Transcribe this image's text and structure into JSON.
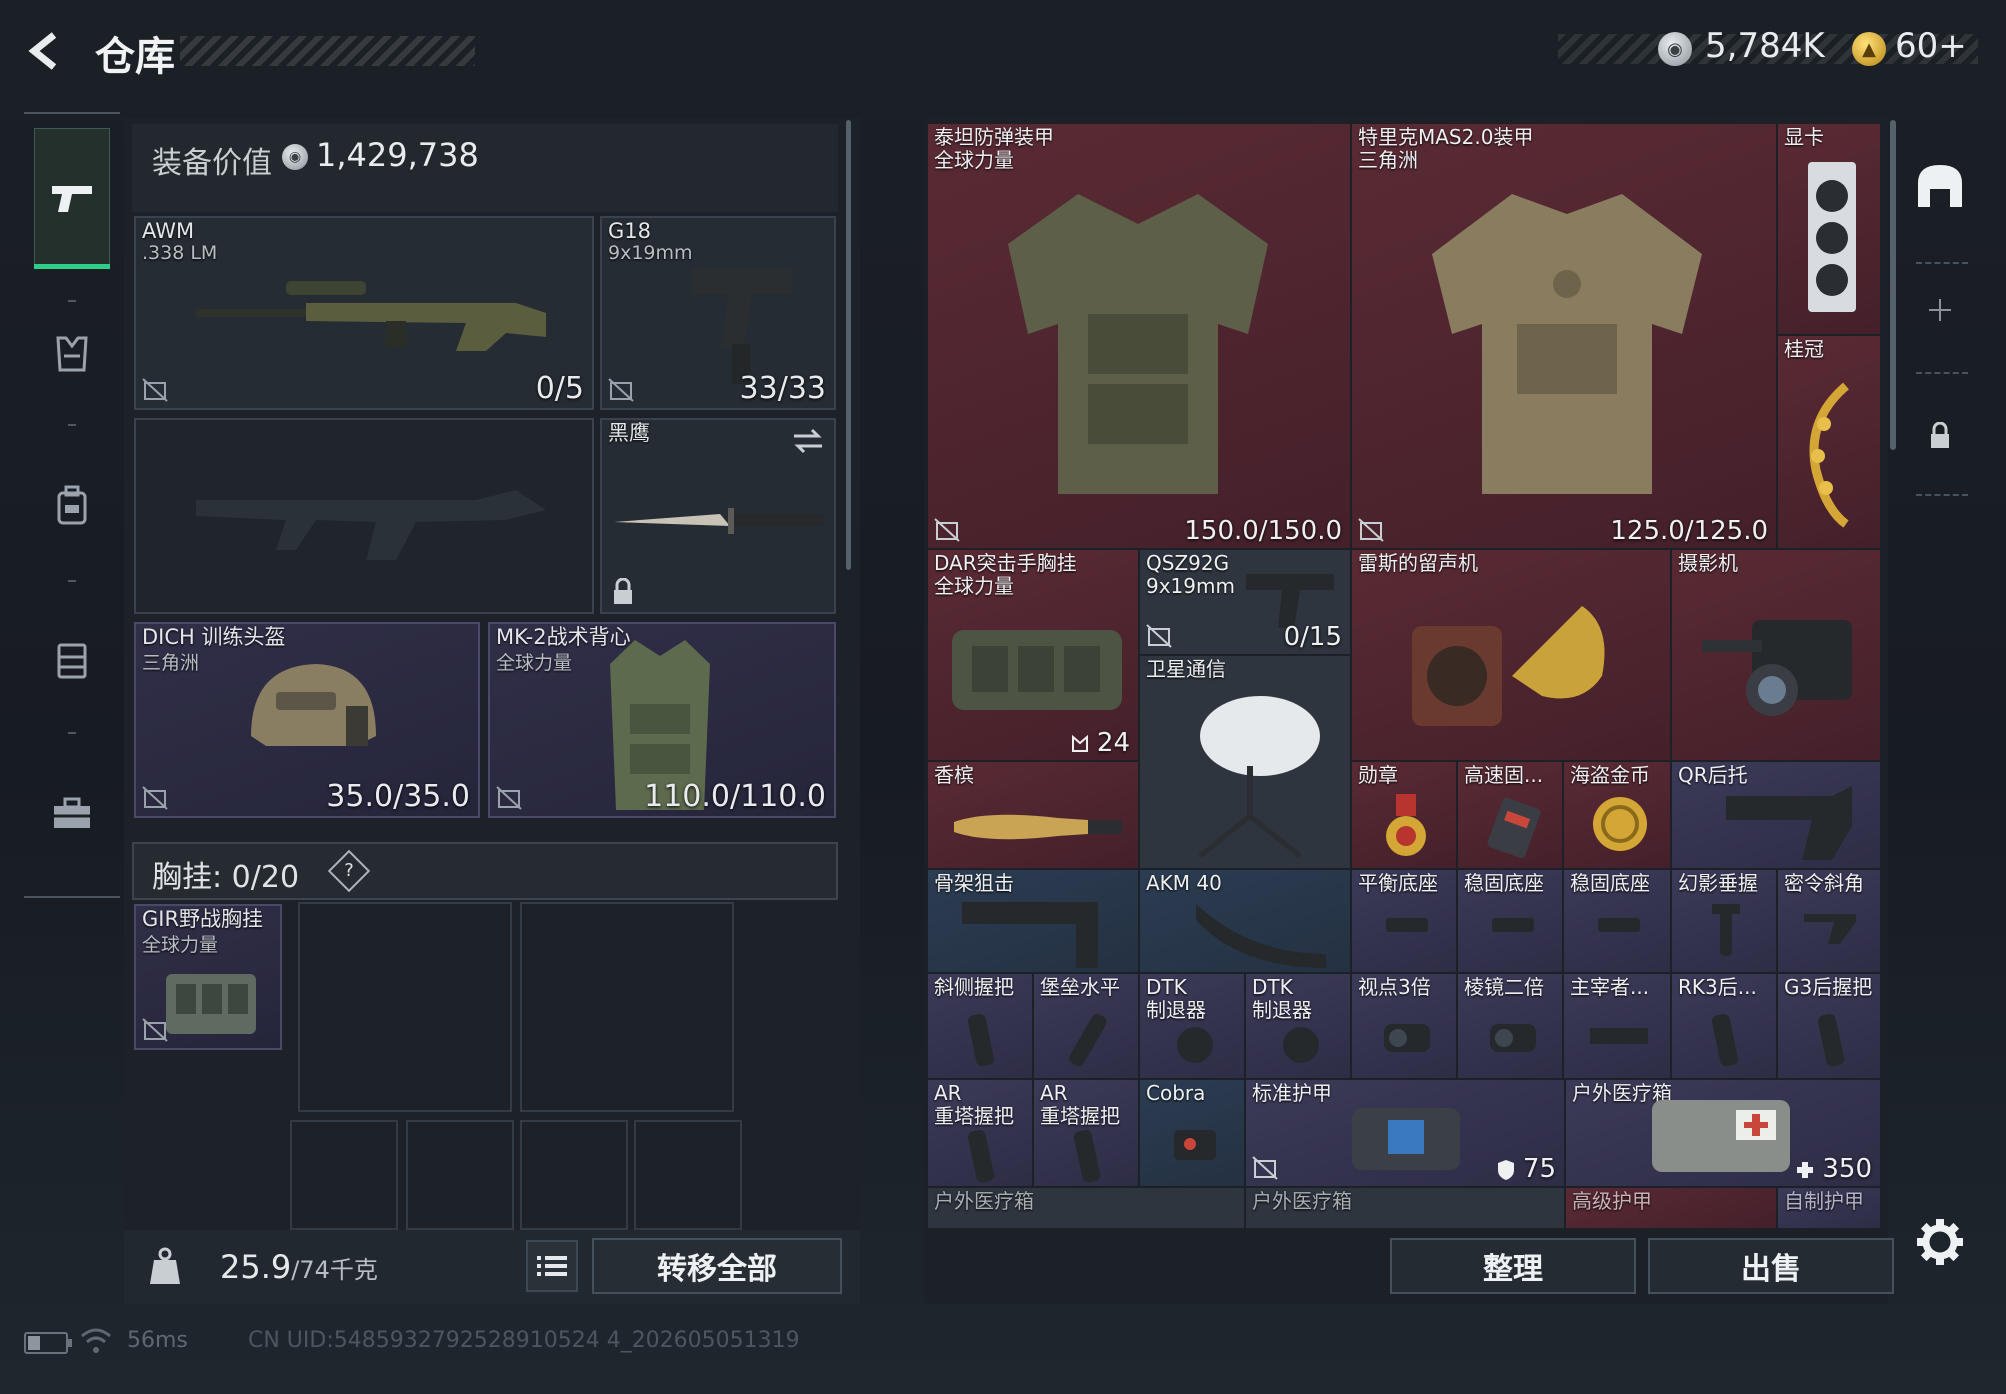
{
  "header": {
    "title": "仓库",
    "silver_icon": "silver-coin-icon",
    "silver_amount": "5,784K",
    "gold_icon": "gold-coin-icon",
    "gold_amount": "60+"
  },
  "sidebar": {
    "items": [
      {
        "name": "weapons",
        "icon": "pistol-icon",
        "active": true
      },
      {
        "name": "armor",
        "icon": "armor-vest-icon"
      },
      {
        "name": "backpack",
        "icon": "backpack-icon"
      },
      {
        "name": "chest-rig",
        "icon": "chest-rig-icon"
      },
      {
        "name": "toolbox",
        "icon": "toolbox-icon"
      }
    ]
  },
  "equipment": {
    "value_label": "装备价值",
    "value_amount": "1,429,738",
    "primary": {
      "name": "AWM",
      "sub": ".338 LM",
      "count": "0/5"
    },
    "sidearm": {
      "name": "G18",
      "sub": "9x19mm",
      "count": "33/33"
    },
    "melee": {
      "name": "黑鹰"
    },
    "helmet": {
      "name": "DICH 训练头盔",
      "sub": "三角洲",
      "count": "35.0/35.0"
    },
    "armor": {
      "name": "MK-2战术背心",
      "sub": "全球力量",
      "count": "110.0/110.0"
    },
    "chest_label": "胸挂:",
    "chest_count": "0/20",
    "chest_help": "?",
    "chest_rig": {
      "name": "GIR野战胸挂",
      "sub": "全球力量"
    }
  },
  "footer_left": {
    "weight_value": "25.9",
    "weight_max": "/74千克",
    "transfer_all": "转移全部"
  },
  "stash": {
    "cells": [
      {
        "id": "titan-armor",
        "label": "泰坦防弹装甲\n全球力量",
        "value": "150.0/150.0"
      },
      {
        "id": "mas-armor",
        "label": "特里克MAS2.0装甲\n三角洲",
        "value": "125.0/125.0"
      },
      {
        "id": "gpu",
        "label": "显卡"
      },
      {
        "id": "laurel",
        "label": "桂冠"
      },
      {
        "id": "dar-rig",
        "label": "DAR突击手胸挂\n全球力量",
        "value": "24"
      },
      {
        "id": "qsz92g",
        "label": "QSZ92G\n9x19mm",
        "value": "0/15"
      },
      {
        "id": "gramophone",
        "label": "雷斯的留声机"
      },
      {
        "id": "camera",
        "label": "摄影机"
      },
      {
        "id": "satcom",
        "label": "卫星通信"
      },
      {
        "id": "champagne",
        "label": "香槟"
      },
      {
        "id": "medal",
        "label": "勋章"
      },
      {
        "id": "ssd",
        "label": "高速固..."
      },
      {
        "id": "pirate-coin",
        "label": "海盗金币"
      },
      {
        "id": "qr-stock",
        "label": "QR后托"
      },
      {
        "id": "skeleton-stock",
        "label": "骨架狙击"
      },
      {
        "id": "akm40",
        "label": "AKM 40"
      },
      {
        "id": "balance-base",
        "label": "平衡底座"
      },
      {
        "id": "stable-base-1",
        "label": "稳固底座"
      },
      {
        "id": "stable-base-2",
        "label": "稳固底座"
      },
      {
        "id": "phantom-grip",
        "label": "幻影垂握"
      },
      {
        "id": "secret-grip",
        "label": "密令斜角"
      },
      {
        "id": "slant-grip",
        "label": "斜侧握把"
      },
      {
        "id": "bastion-grip",
        "label": "堡垒水平"
      },
      {
        "id": "dtk-1",
        "label": "DTK\n制退器"
      },
      {
        "id": "dtk-2",
        "label": "DTK\n制退器"
      },
      {
        "id": "scope-3x",
        "label": "视点3倍"
      },
      {
        "id": "prism-2x",
        "label": "棱镜二倍"
      },
      {
        "id": "dominator",
        "label": "主宰者..."
      },
      {
        "id": "rk3",
        "label": "RK3后..."
      },
      {
        "id": "g3-grip",
        "label": "G3后握把"
      },
      {
        "id": "ar-grip-1",
        "label": "AR\n重塔握把"
      },
      {
        "id": "ar-grip-2",
        "label": "AR\n重塔握把"
      },
      {
        "id": "cobra",
        "label": "Cobra"
      },
      {
        "id": "std-armor-plate",
        "label": "标准护甲",
        "value": "75"
      },
      {
        "id": "field-medkit",
        "label": "户外医疗箱",
        "value": "350"
      },
      {
        "id": "medkit-b1",
        "label": "户外医疗箱"
      },
      {
        "id": "medkit-b2",
        "label": "户外医疗箱"
      },
      {
        "id": "adv-armor",
        "label": "高级护甲"
      },
      {
        "id": "self-armor",
        "label": "自制护甲"
      }
    ]
  },
  "stash_footer": {
    "organize": "整理",
    "sell": "出售"
  },
  "right_rail": {
    "items": [
      {
        "name": "stash-home",
        "icon": "stash-home-icon"
      },
      {
        "name": "add",
        "icon": "plus-icon"
      },
      {
        "name": "lock",
        "icon": "lock-icon"
      }
    ],
    "settings_icon": "gear-icon"
  },
  "status": {
    "ping": "56ms",
    "uid": "CN UID:5485932792528910524 4_202605051319"
  },
  "colors": {
    "accent_green": "#2ecf8a",
    "rarity_red": "#5a2a34",
    "rarity_purple": "#3b3a58",
    "rarity_blue": "#2c3c52"
  }
}
